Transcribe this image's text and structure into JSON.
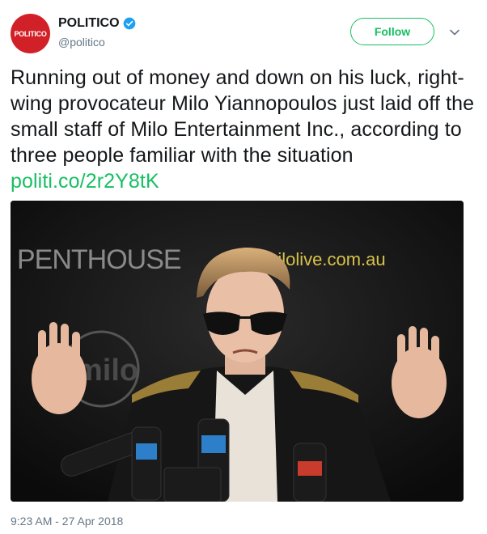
{
  "account": {
    "avatar_text": "POLITICO",
    "display_name": "POLITICO",
    "handle": "@politico",
    "verified": true
  },
  "actions": {
    "follow_label": "Follow"
  },
  "tweet": {
    "text": "Running out of money and down on his luck, right-wing provocateur Milo Yiannopoulos just laid off the small staff of Milo Entertainment Inc., according to three people familiar with the situation ",
    "link": "politi.co/2r2Y8tK",
    "timestamp": "9:23 AM - 27 Apr 2018"
  },
  "photo": {
    "backdrop_brand": "PENTHOUSE",
    "backdrop_url": "milolive.com.au",
    "backdrop_logo": "milo"
  },
  "colors": {
    "accent": "#17bf63",
    "avatar": "#d22028",
    "verified": "#1da1f2",
    "muted": "#657786"
  }
}
